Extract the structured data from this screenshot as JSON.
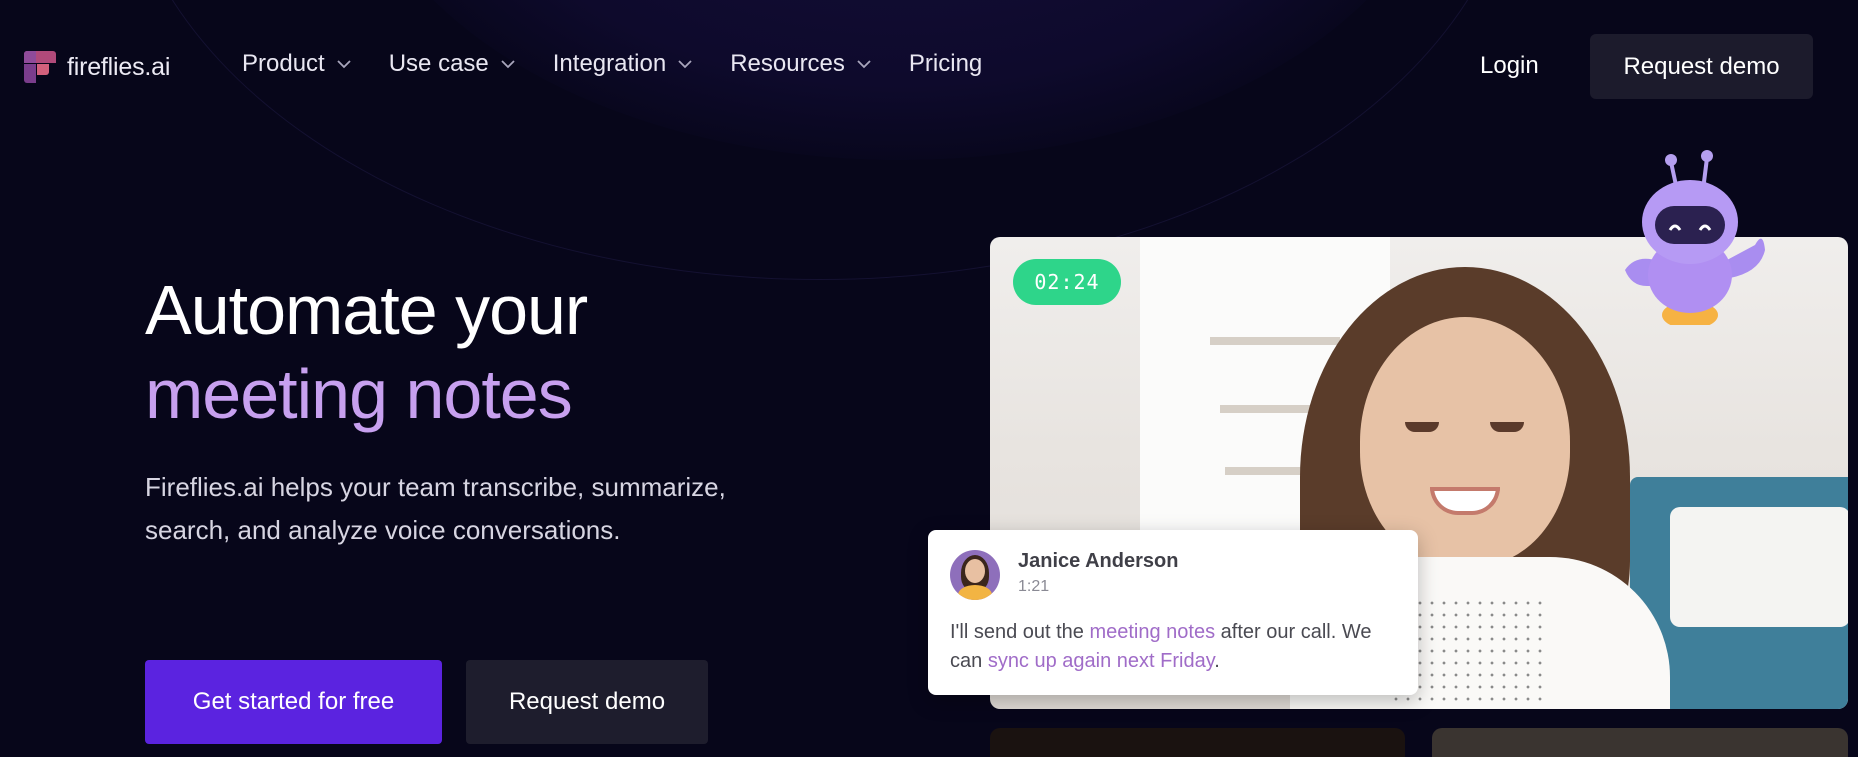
{
  "brand": {
    "name": "fireflies.ai"
  },
  "nav": {
    "items": [
      {
        "label": "Product",
        "has_dropdown": true
      },
      {
        "label": "Use case",
        "has_dropdown": true
      },
      {
        "label": "Integration",
        "has_dropdown": true
      },
      {
        "label": "Resources",
        "has_dropdown": true
      },
      {
        "label": "Pricing",
        "has_dropdown": false
      }
    ],
    "login": "Login",
    "request_demo": "Request demo"
  },
  "hero": {
    "title_line1": "Automate your",
    "title_line2": "meeting notes",
    "subtitle": "Fireflies.ai helps your team transcribe, summarize, search, and analyze voice conversations.",
    "cta_primary": "Get started for free",
    "cta_secondary": "Request demo"
  },
  "video": {
    "timer": "02:24"
  },
  "chat": {
    "name": "Janice Anderson",
    "time": "1:21",
    "text_part1": "I'll send out the ",
    "highlight1": "meeting notes",
    "text_part2": " after our call. We can ",
    "highlight2": "sync up again next Friday",
    "text_part3": "."
  },
  "colors": {
    "background": "#07061a",
    "accent_purple": "#5b23e0",
    "title_highlight": "#c7a0ef",
    "timer_green": "#2ed58a",
    "chat_highlight": "#a06cc8"
  },
  "icons": [
    "fireflies-logo-icon",
    "chevron-down-icon",
    "robot-mascot-icon"
  ]
}
